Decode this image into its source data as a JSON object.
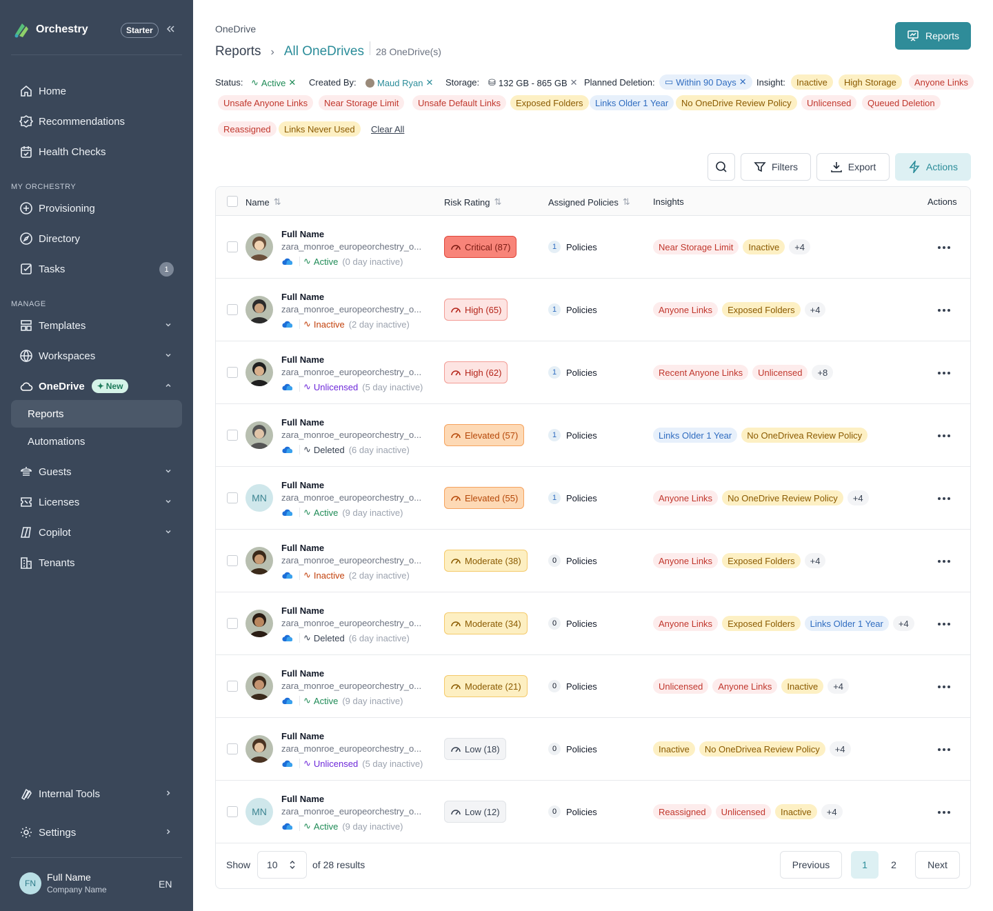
{
  "sidebar": {
    "brand": "Orchestry",
    "plan": "Starter",
    "nav_top": [
      {
        "label": "Home",
        "icon": "home-icon"
      },
      {
        "label": "Recommendations",
        "icon": "badge-check-icon"
      },
      {
        "label": "Health Checks",
        "icon": "calendar-check-icon"
      }
    ],
    "section_my": "MY ORCHESTRY",
    "nav_my": [
      {
        "label": "Provisioning",
        "icon": "plus-circle-icon"
      },
      {
        "label": "Directory",
        "icon": "compass-icon"
      },
      {
        "label": "Tasks",
        "icon": "checkbox-icon",
        "count": "1"
      }
    ],
    "section_manage": "MANAGE",
    "nav_manage": [
      {
        "label": "Templates",
        "icon": "layout-icon"
      },
      {
        "label": "Workspaces",
        "icon": "globe-icon"
      },
      {
        "label": "OneDrive",
        "icon": "cloud-icon",
        "badge": "New"
      },
      {
        "label": "Reports"
      },
      {
        "label": "Automations"
      },
      {
        "label": "Guests",
        "icon": "guests-icon"
      },
      {
        "label": "Licenses",
        "icon": "licenses-icon"
      },
      {
        "label": "Copilot",
        "icon": "copilot-icon"
      },
      {
        "label": "Tenants",
        "icon": "building-icon"
      }
    ],
    "nav_bottom": [
      {
        "label": "Internal Tools",
        "icon": "tools-icon"
      },
      {
        "label": "Settings",
        "icon": "gear-icon"
      }
    ],
    "user": {
      "initials": "FN",
      "name": "Full Name",
      "company": "Company Name",
      "lang": "EN"
    }
  },
  "header": {
    "breadcrumb_top": "OneDrive",
    "crumb_reports": "Reports",
    "crumb_all": "All OneDrives",
    "count": "28 OneDrive(s)",
    "reports_button": "Reports"
  },
  "filters": {
    "status_label": "Status:",
    "status_value": "Active",
    "created_label": "Created By:",
    "created_value": "Maud Ryan",
    "storage_label": "Storage:",
    "storage_value": "132 GB - 865 GB",
    "deletion_label": "Planned Deletion:",
    "deletion_value": "Within 90 Days",
    "insight_label": "Insight:",
    "insights_row1": [
      "Inactive",
      "High Storage",
      "Anyone Links"
    ],
    "insights_row2": [
      "Unsafe Anyone Links",
      "Near Storage Limit",
      "Unsafe Default Links",
      "Exposed Folders",
      "Links Older 1 Year",
      "No OneDrive Review Policy",
      "Unlicensed",
      "Queued Deletion"
    ],
    "insights_row3": [
      "Reassigned",
      "Links Never Used"
    ],
    "clear_all": "Clear All"
  },
  "toolbar": {
    "filters": "Filters",
    "export": "Export",
    "actions": "Actions"
  },
  "table": {
    "headers": {
      "name": "Name",
      "risk": "Risk Rating",
      "policies": "Assigned Policies",
      "insights": "Insights",
      "actions": "Actions"
    },
    "rows": [
      {
        "name": "Full Name",
        "email": "zara_monroe_europeorchestry_o...",
        "status": "Active",
        "inactive": "(0 day inactive)",
        "risk": "Critical (87)",
        "level": "crit",
        "policies": "1",
        "policies_label": "Policies",
        "insights": [
          [
            "Near Storage Limit",
            "red"
          ],
          [
            "Inactive",
            "yellow"
          ]
        ],
        "more": "+4",
        "avatar": "photo"
      },
      {
        "name": "Full Name",
        "email": "zara_monroe_europeorchestry_o...",
        "status": "Inactive",
        "inactive": "(2 day inactive)",
        "risk": "High (65)",
        "level": "high",
        "policies": "1",
        "policies_label": "Policies",
        "insights": [
          [
            "Anyone Links",
            "red"
          ],
          [
            "Exposed Folders",
            "yellow"
          ]
        ],
        "more": "+4",
        "avatar": "photo"
      },
      {
        "name": "Full Name",
        "email": "zara_monroe_europeorchestry_o...",
        "status": "Unlicensed",
        "inactive": "(5 day inactive)",
        "risk": "High (62)",
        "level": "high",
        "policies": "1",
        "policies_label": "Policies",
        "insights": [
          [
            "Recent Anyone Links",
            "red"
          ],
          [
            "Unlicensed",
            "red"
          ]
        ],
        "more": "+8",
        "avatar": "photo"
      },
      {
        "name": "Full Name",
        "email": "zara_monroe_europeorchestry_o...",
        "status": "Deleted",
        "inactive": "(6 day inactive)",
        "risk": "Elevated (57)",
        "level": "elev",
        "policies": "1",
        "policies_label": "Policies",
        "insights": [
          [
            "Links Older 1 Year",
            "blue"
          ],
          [
            "No OneDrivea Review Policy",
            "yellow"
          ]
        ],
        "more": "",
        "avatar": "photo"
      },
      {
        "name": "Full Name",
        "email": "zara_monroe_europeorchestry_o...",
        "status": "Active",
        "inactive": "(9 day inactive)",
        "risk": "Elevated (55)",
        "level": "elev",
        "policies": "1",
        "policies_label": "Policies",
        "insights": [
          [
            "Anyone Links",
            "red"
          ],
          [
            "No OneDrive Review Policy",
            "yellow"
          ]
        ],
        "more": "+4",
        "avatar": "MN"
      },
      {
        "name": "Full Name",
        "email": "zara_monroe_europeorchestry_o...",
        "status": "Inactive",
        "inactive": "(2 day inactive)",
        "risk": "Moderate (38)",
        "level": "mod",
        "policies": "0",
        "policies_label": "Policies",
        "insights": [
          [
            "Anyone Links",
            "red"
          ],
          [
            "Exposed Folders",
            "yellow"
          ]
        ],
        "more": "+4",
        "avatar": "photo"
      },
      {
        "name": "Full Name",
        "email": "zara_monroe_europeorchestry_o...",
        "status": "Deleted",
        "inactive": "(6 day inactive)",
        "risk": "Moderate (34)",
        "level": "mod",
        "policies": "0",
        "policies_label": "Policies",
        "insights": [
          [
            "Anyone Links",
            "red"
          ],
          [
            "Exposed Folders",
            "yellow"
          ],
          [
            "Links Older 1 Year",
            "blue"
          ]
        ],
        "more": "+4",
        "avatar": "photo"
      },
      {
        "name": "Full Name",
        "email": "zara_monroe_europeorchestry_o...",
        "status": "Active",
        "inactive": "(9 day inactive)",
        "risk": "Moderate (21)",
        "level": "mod",
        "policies": "0",
        "policies_label": "Policies",
        "insights": [
          [
            "Unlicensed",
            "red"
          ],
          [
            "Anyone Links",
            "red"
          ],
          [
            "Inactive",
            "yellow"
          ]
        ],
        "more": "+4",
        "avatar": "photo"
      },
      {
        "name": "Full Name",
        "email": "zara_monroe_europeorchestry_o...",
        "status": "Unlicensed",
        "inactive": "(5 day inactive)",
        "risk": "Low (18)",
        "level": "low",
        "policies": "0",
        "policies_label": "Policies",
        "insights": [
          [
            "Inactive",
            "yellow"
          ],
          [
            "No OneDrivea Review Policy",
            "yellow"
          ]
        ],
        "more": "+4",
        "avatar": "photo"
      },
      {
        "name": "Full Name",
        "email": "zara_monroe_europeorchestry_o...",
        "status": "Active",
        "inactive": "(9 day inactive)",
        "risk": "Low (12)",
        "level": "low",
        "policies": "0",
        "policies_label": "Policies",
        "insights": [
          [
            "Reassigned",
            "red"
          ],
          [
            "Unlicensed",
            "red"
          ],
          [
            "Inactive",
            "yellow"
          ]
        ],
        "more": "+4",
        "avatar": "MN"
      }
    ]
  },
  "pagination": {
    "show": "Show",
    "page_size": "10",
    "results": "of 28 results",
    "previous": "Previous",
    "pages": [
      "1",
      "2"
    ],
    "current": "1",
    "next": "Next"
  },
  "colors": {
    "sidebar": "#3a4759",
    "accent": "#2f8c99"
  }
}
